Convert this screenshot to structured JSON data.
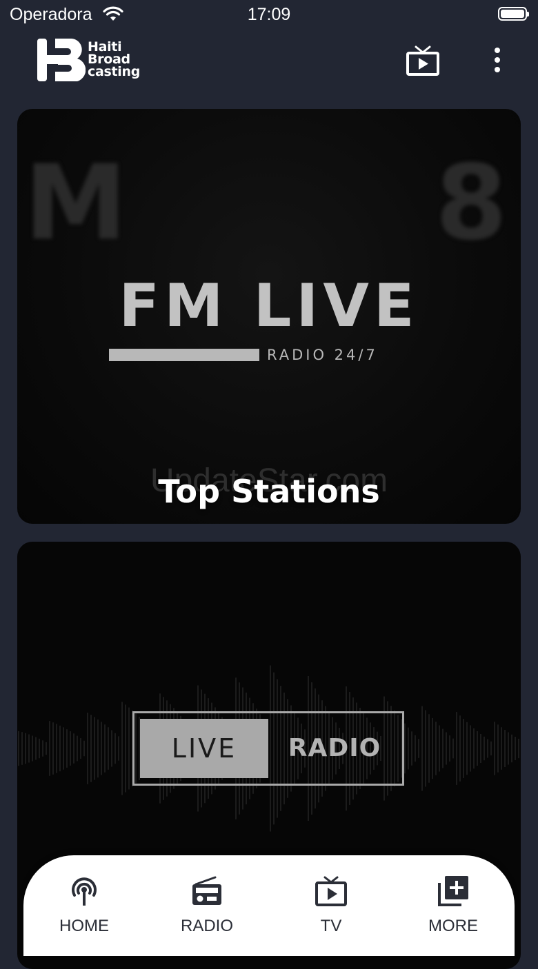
{
  "status_bar": {
    "carrier": "Operadora",
    "time": "17:09"
  },
  "app_bar": {
    "logo_lines": [
      "Haiti",
      "Broad",
      "casting"
    ]
  },
  "cards": [
    {
      "artwork_title": "FM LIVE",
      "artwork_subtitle": "RADIO 24/7",
      "watermark": "UpdateStar.com",
      "title": "Top Stations"
    },
    {
      "badge_left": "LIVE",
      "badge_right": "RADIO"
    }
  ],
  "tabbar": {
    "items": [
      {
        "label": "HOME",
        "icon": "broadcast-icon"
      },
      {
        "label": "RADIO",
        "icon": "radio-icon"
      },
      {
        "label": "TV",
        "icon": "tv-icon"
      },
      {
        "label": "MORE",
        "icon": "add-library-icon"
      }
    ]
  },
  "colors": {
    "background": "#222633",
    "tabbar": "#ffffff",
    "tab_icon": "#2b2e37"
  }
}
